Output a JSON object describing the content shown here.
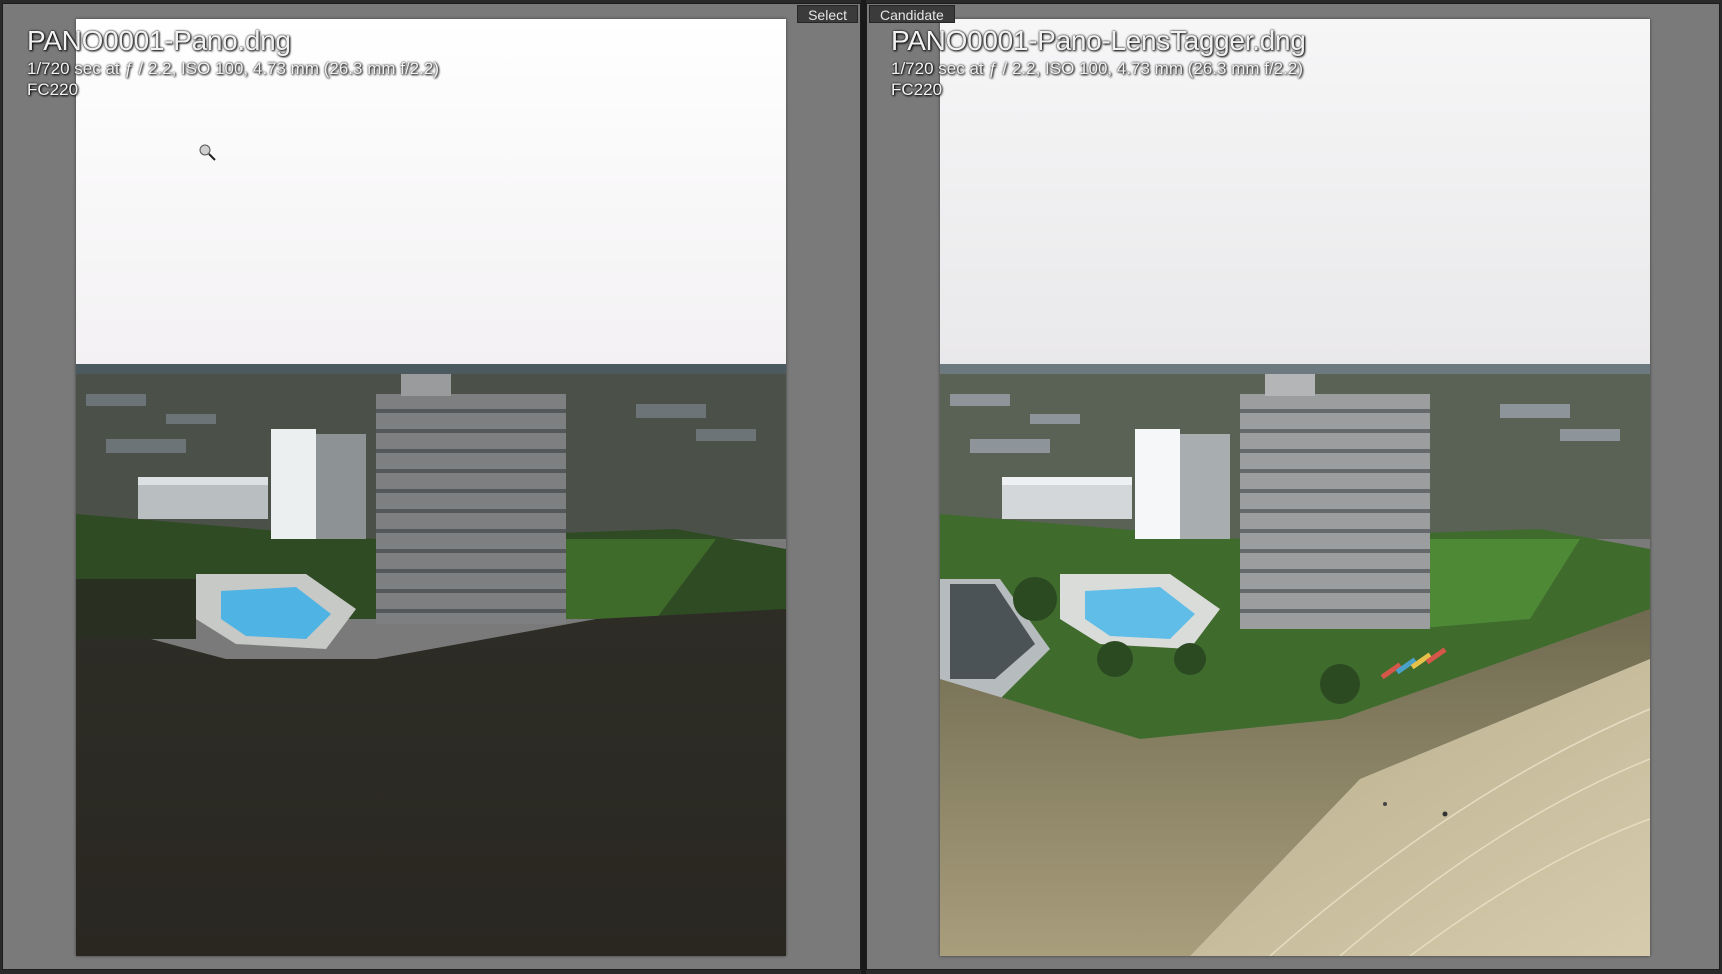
{
  "panes": {
    "select": {
      "tag": "Select",
      "filename": "PANO0001-Pano.dng",
      "exif": "1/720 sec at ƒ / 2.2, ISO 100, 4.73 mm (26.3 mm f/2.2)",
      "camera": "FC220"
    },
    "candidate": {
      "tag": "Candidate",
      "filename": "PANO0001-Pano-LensTagger.dng",
      "exif": "1/720 sec at ƒ / 2.2, ISO 100, 4.73 mm (26.3 mm f/2.2)",
      "camera": "FC220"
    }
  },
  "colors": {
    "panel_bg": "#7a7a7a",
    "sky": "#f7f7f8",
    "lawn": "#3f6b2d",
    "pool": "#4fb3e3",
    "sand": "#cbbf9c",
    "shadow_dark": "#2c2a24"
  },
  "icons": {
    "cursor": "zoom-magnifier-icon"
  }
}
